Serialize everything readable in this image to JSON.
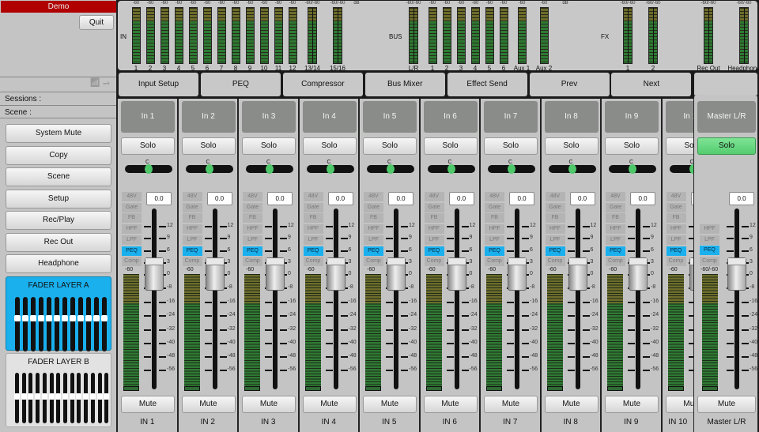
{
  "session_name": "Demo",
  "quit_label": "Quit",
  "status_icons": [
    "wifi-icon",
    "usb-icon"
  ],
  "sessions_label": "Sessions :",
  "scene_label": "Scene :",
  "left_buttons": [
    "System Mute",
    "Copy",
    "Scene",
    "Setup",
    "Rec/Play",
    "Rec Out",
    "Headphone"
  ],
  "fader_layers": [
    {
      "label": "FADER LAYER A",
      "active": true
    },
    {
      "label": "FADER LAYER B",
      "active": false
    }
  ],
  "meter_bridge": {
    "in_label": "IN",
    "bus_label": "BUS",
    "fx_label": "FX",
    "db_label": "dB",
    "in_meters": [
      {
        "label": "1",
        "top": "-60"
      },
      {
        "label": "2",
        "top": "-60"
      },
      {
        "label": "3",
        "top": "-60"
      },
      {
        "label": "4",
        "top": "-60"
      },
      {
        "label": "5",
        "top": "-60"
      },
      {
        "label": "6",
        "top": "-60"
      },
      {
        "label": "7",
        "top": "-60"
      },
      {
        "label": "8",
        "top": "-60"
      },
      {
        "label": "9",
        "top": "-60"
      },
      {
        "label": "10",
        "top": "-60"
      },
      {
        "label": "11",
        "top": "-60"
      },
      {
        "label": "12",
        "top": "-60"
      },
      {
        "label": "13/14",
        "top": "-60/-60"
      },
      {
        "label": "15/16",
        "top": "-60/-60"
      }
    ],
    "bus_meters": [
      {
        "label": "L/R",
        "top": "-60/-60"
      },
      {
        "label": "1",
        "top": "-60"
      },
      {
        "label": "2",
        "top": "-60"
      },
      {
        "label": "3",
        "top": "-60"
      },
      {
        "label": "4",
        "top": "-60"
      },
      {
        "label": "5",
        "top": "-60"
      },
      {
        "label": "6",
        "top": "-60"
      },
      {
        "label": "Aux 1",
        "top": "-60"
      },
      {
        "label": "Aux 2",
        "top": "-60"
      }
    ],
    "fx_meters": [
      {
        "label": "1",
        "top": "-60/-60"
      },
      {
        "label": "2",
        "top": "-60/-60"
      }
    ],
    "out_meters": [
      {
        "label": "Rec Out",
        "top": "-60/-60"
      },
      {
        "label": "Headphone",
        "top": "-60/-60"
      }
    ]
  },
  "tabs": [
    "Input Setup",
    "PEQ",
    "Compressor",
    "Bus Mixer",
    "Effect Send",
    "Prev",
    "Next"
  ],
  "scale": [
    "12",
    "9",
    "6",
    "3",
    "0",
    "-8",
    "-16",
    "-24",
    "-32",
    "-40",
    "-48",
    "-56"
  ],
  "channel_buttons": [
    "48V",
    "Gate",
    "FB",
    "HPF",
    "LPF",
    "PEQ",
    "Comp"
  ],
  "active_button": "PEQ",
  "solo_label": "Solo",
  "mute_label": "Mute",
  "pan_label": "C",
  "meter_top": "-60",
  "channels": [
    {
      "name": "In 1",
      "label": "IN 1",
      "value": "0.0"
    },
    {
      "name": "In 2",
      "label": "IN 2",
      "value": "0.0"
    },
    {
      "name": "In 3",
      "label": "IN 3",
      "value": "0.0"
    },
    {
      "name": "In 4",
      "label": "IN 4",
      "value": "0.0"
    },
    {
      "name": "In 5",
      "label": "IN 5",
      "value": "0.0"
    },
    {
      "name": "In 6",
      "label": "IN 6",
      "value": "0.0"
    },
    {
      "name": "In 7",
      "label": "IN 7",
      "value": "0.0"
    },
    {
      "name": "In 8",
      "label": "IN 8",
      "value": "0.0"
    },
    {
      "name": "In 9",
      "label": "IN 9",
      "value": "0.0"
    },
    {
      "name": "In 10",
      "label": "IN 10",
      "value": "0.0"
    }
  ],
  "master": {
    "name": "Master L/R",
    "label": "Master L/R",
    "value": "0.0",
    "solo_active": true,
    "buttons": [
      "HPF",
      "LPF",
      "PEQ",
      "Comp"
    ],
    "meter_top": "-60/-60"
  },
  "colors": {
    "accent": "#1ab0ee",
    "solo_active": "#5fd67a",
    "session_bar": "#b00000"
  }
}
